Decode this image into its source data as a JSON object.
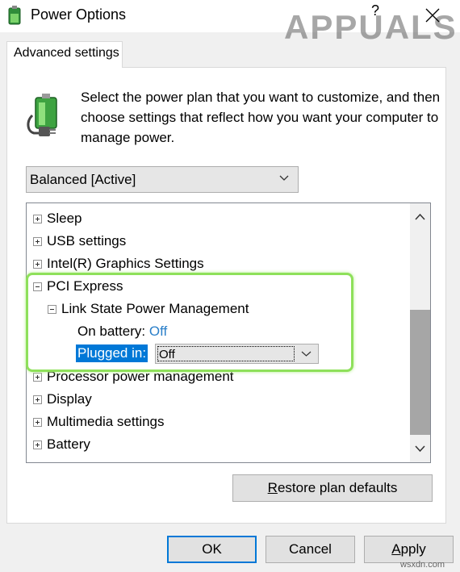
{
  "window": {
    "title": "Power Options",
    "help": "?"
  },
  "watermark": "APPUALS",
  "tab": {
    "label": "Advanced settings"
  },
  "description": "Select the power plan that you want to customize, and then choose settings that reflect how you want your computer to manage power.",
  "plan_select": {
    "value": "Balanced [Active]"
  },
  "tree": {
    "items": [
      {
        "label": "Sleep",
        "state": "collapsed"
      },
      {
        "label": "USB settings",
        "state": "collapsed"
      },
      {
        "label": "Intel(R) Graphics Settings",
        "state": "collapsed"
      },
      {
        "label": "PCI Express",
        "state": "expanded"
      },
      {
        "label": "Link State Power Management",
        "state": "expanded"
      },
      {
        "label": "Processor power management",
        "state": "collapsed"
      },
      {
        "label": "Display",
        "state": "collapsed"
      },
      {
        "label": "Multimedia settings",
        "state": "collapsed"
      },
      {
        "label": "Battery",
        "state": "collapsed"
      }
    ],
    "on_battery": {
      "label": "On battery:",
      "value": "Off"
    },
    "plugged_in": {
      "label": "Plugged in:",
      "value": "Off"
    }
  },
  "buttons": {
    "restore": {
      "first": "R",
      "rest": "estore plan defaults"
    },
    "ok": "OK",
    "cancel": "Cancel",
    "apply": {
      "first": "A",
      "rest": "pply"
    }
  },
  "site_label": "wsxdn.com",
  "colors": {
    "accent": "#0078d7",
    "highlight_outline": "#8ee05a",
    "value_link": "#2a7fc9"
  }
}
